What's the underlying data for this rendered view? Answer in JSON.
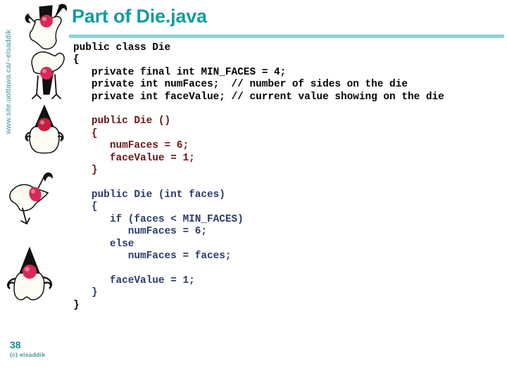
{
  "slide": {
    "title": "Part of Die.java",
    "title_color": "#169b9e",
    "rule_color": "#8ed3d4",
    "background": "#ffffff"
  },
  "sidebar": {
    "url_text": "www.site.uottawa.ca/~elsaddik",
    "url_color": "#3c8f93",
    "mascots": [
      {
        "name": "duke-mascot-waving",
        "pose": "arms-up"
      },
      {
        "name": "duke-mascot-inverted",
        "pose": "upside-down"
      },
      {
        "name": "duke-mascot-upright",
        "pose": "standing"
      },
      {
        "name": "duke-mascot-tilted",
        "pose": "rotated-left"
      },
      {
        "name": "duke-mascot-standing",
        "pose": "arms-out"
      }
    ]
  },
  "footer": {
    "slide_number": "38",
    "copyright": "(c) elsaddik",
    "number_color": "#17878c",
    "copyright_color": "#3f9296"
  },
  "code": {
    "language": "java",
    "filename": "Die.java",
    "lines": [
      {
        "text": "public class Die",
        "color": "black"
      },
      {
        "text": "{",
        "color": "black"
      },
      {
        "text": "   private final int MIN_FACES = 4;",
        "color": "black"
      },
      {
        "text": "   private int numFaces;  // number of sides on the die",
        "color": "black"
      },
      {
        "text": "   private int faceValue; // current value showing on the die",
        "color": "black"
      },
      {
        "text": "",
        "color": "blank"
      },
      {
        "text": "   public Die ()",
        "color": "maroon"
      },
      {
        "text": "   {",
        "color": "maroon"
      },
      {
        "text": "      numFaces = 6;",
        "color": "maroon"
      },
      {
        "text": "      faceValue = 1;",
        "color": "maroon"
      },
      {
        "text": "   }",
        "color": "maroon"
      },
      {
        "text": "",
        "color": "blank"
      },
      {
        "text": "   public Die (int faces)",
        "color": "navy"
      },
      {
        "text": "   {",
        "color": "navy"
      },
      {
        "text": "      if (faces < MIN_FACES)",
        "color": "navy"
      },
      {
        "text": "         numFaces = 6;",
        "color": "navy"
      },
      {
        "text": "      else",
        "color": "navy"
      },
      {
        "text": "         numFaces = faces;",
        "color": "navy"
      },
      {
        "text": "",
        "color": "blank"
      },
      {
        "text": "      faceValue = 1;",
        "color": "navy"
      },
      {
        "text": "   }",
        "color": "navy"
      },
      {
        "text": "}",
        "color": "black"
      }
    ],
    "colors": {
      "black": "#000000",
      "maroon": "#6b1414",
      "navy": "#2a3a6b"
    }
  }
}
